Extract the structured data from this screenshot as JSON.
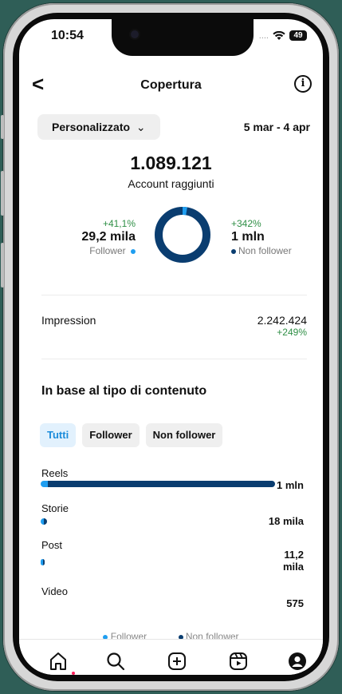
{
  "status": {
    "time": "10:54",
    "signal": "....",
    "battery": "49"
  },
  "header": {
    "title": "Copertura",
    "back": "<",
    "info": "i"
  },
  "filter": {
    "label": "Personalizzato",
    "chevron": "⌄",
    "date_range": "5 mar - 4 apr"
  },
  "summary": {
    "total": "1.089.121",
    "label": "Account raggiunti"
  },
  "followers": {
    "change": "+41,1%",
    "value": "29,2 mila",
    "label": "Follower"
  },
  "non_followers": {
    "change": "+342%",
    "value": "1 mln",
    "label": "Non follower"
  },
  "impressions": {
    "label": "Impression",
    "value": "2.242.424",
    "change": "+249%"
  },
  "content": {
    "title": "In base al tipo di contenuto",
    "chips": [
      "Tutti",
      "Follower",
      "Non follower"
    ],
    "rows": [
      {
        "label": "Reels",
        "value": "1 mln",
        "follower_fraction": 0.03,
        "fill": 1.0
      },
      {
        "label": "Storie",
        "value": "18 mila",
        "follower_fraction": 0.5,
        "fill": 0.027
      },
      {
        "label": "Post",
        "value": "11,2 mila",
        "follower_fraction": 0.5,
        "fill": 0.014
      },
      {
        "label": "Video",
        "value": "575",
        "follower_fraction": 0.5,
        "fill": 0.0
      }
    ]
  },
  "legend": {
    "follower": "Follower",
    "non_follower": "Non follower"
  },
  "donut": {
    "follower_fraction": 0.027
  },
  "colors": {
    "follower": "#1f9ef0",
    "non_follower": "#0a3d70",
    "positive": "#2f8f46"
  },
  "tabs": [
    "home-icon",
    "search-icon",
    "create-icon",
    "reels-icon",
    "profile-icon"
  ]
}
